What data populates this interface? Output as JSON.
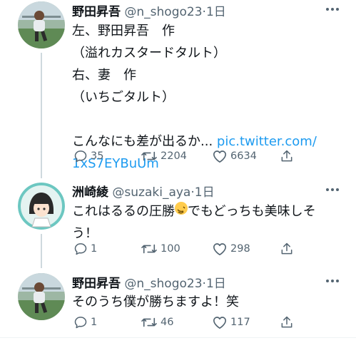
{
  "tweets": [
    {
      "name": "野田昇吾",
      "handle": "@n_shogo23",
      "time": "·1日",
      "lines": [
        "左、野田昇吾　作",
        "（溢れカスタードタルト）",
        "右、妻　作",
        "（いちごタルト）",
        "",
        "こんなにも差が出るか..."
      ],
      "link_part1": "pic.twitter.com/",
      "link_part2": "1xS7EYBuUm",
      "replies": "35",
      "retweets": "2204",
      "likes": "6634"
    },
    {
      "name": "洲崎綾",
      "handle": "@suzaki_aya",
      "time": "·1日",
      "line1_before_emoji": "これはるるの圧勝",
      "line1_after_emoji": "でもどっちも美味しそ",
      "line2": "う！",
      "emoji": "rolling-on-floor-laughing-emoji",
      "replies": "1",
      "retweets": "100",
      "likes": "298"
    },
    {
      "name": "野田昇吾",
      "handle": "@n_shogo23",
      "time": "·1日",
      "line1": "そのうち僕が勝ちますよ！笑",
      "replies": "1",
      "retweets": "46",
      "likes": "117"
    }
  ],
  "colors": {
    "link": "#1d9bf0",
    "secondary": "#536471",
    "thread": "#cfd9de"
  }
}
